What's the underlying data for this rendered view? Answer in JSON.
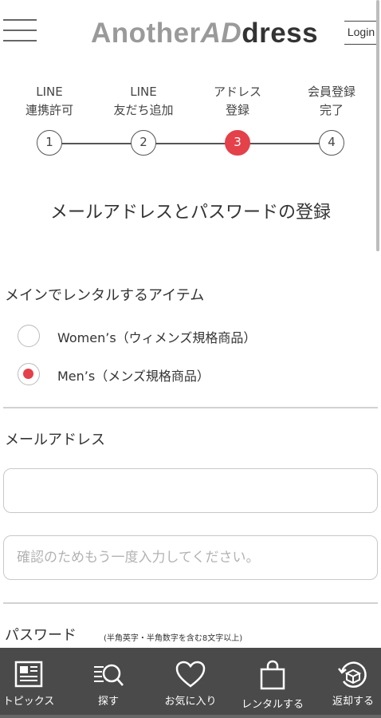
{
  "header": {
    "logo_part1": "Another",
    "logo_part2": "AD",
    "logo_part3": "dress",
    "login_label": "Login"
  },
  "steps": [
    {
      "line1": "LINE",
      "line2": "連携許可",
      "number": "1",
      "active": false
    },
    {
      "line1": "LINE",
      "line2": "友だち追加",
      "number": "2",
      "active": false
    },
    {
      "line1": "アドレス",
      "line2": "登録",
      "number": "3",
      "active": true
    },
    {
      "line1": "会員登録",
      "line2": "完了",
      "number": "4",
      "active": false
    }
  ],
  "page_title": "メールアドレスとパスワードの登録",
  "rental_item": {
    "label": "メインでレンタルするアイテム",
    "options": [
      {
        "label": "Women’s（ウィメンズ規格商品）",
        "checked": false
      },
      {
        "label": "Men’s（メンズ規格商品）",
        "checked": true
      }
    ]
  },
  "email": {
    "label": "メールアドレス",
    "value": "",
    "confirm_placeholder": "確認のためもう一度入力してください。"
  },
  "password": {
    "label": "パスワード",
    "note": "(半角英字・半角数字を含む8文字以上)"
  },
  "tabbar": [
    {
      "label": "トピックス",
      "icon": "newspaper-icon"
    },
    {
      "label": "探す",
      "icon": "search-list-icon"
    },
    {
      "label": "お気に入り",
      "icon": "heart-icon"
    },
    {
      "label": "レンタルする",
      "icon": "shopping-bag-icon"
    },
    {
      "label": "返却する",
      "icon": "return-box-icon"
    }
  ],
  "colors": {
    "accent": "#e4414a",
    "tabbar_bg": "#4a4a4a"
  }
}
